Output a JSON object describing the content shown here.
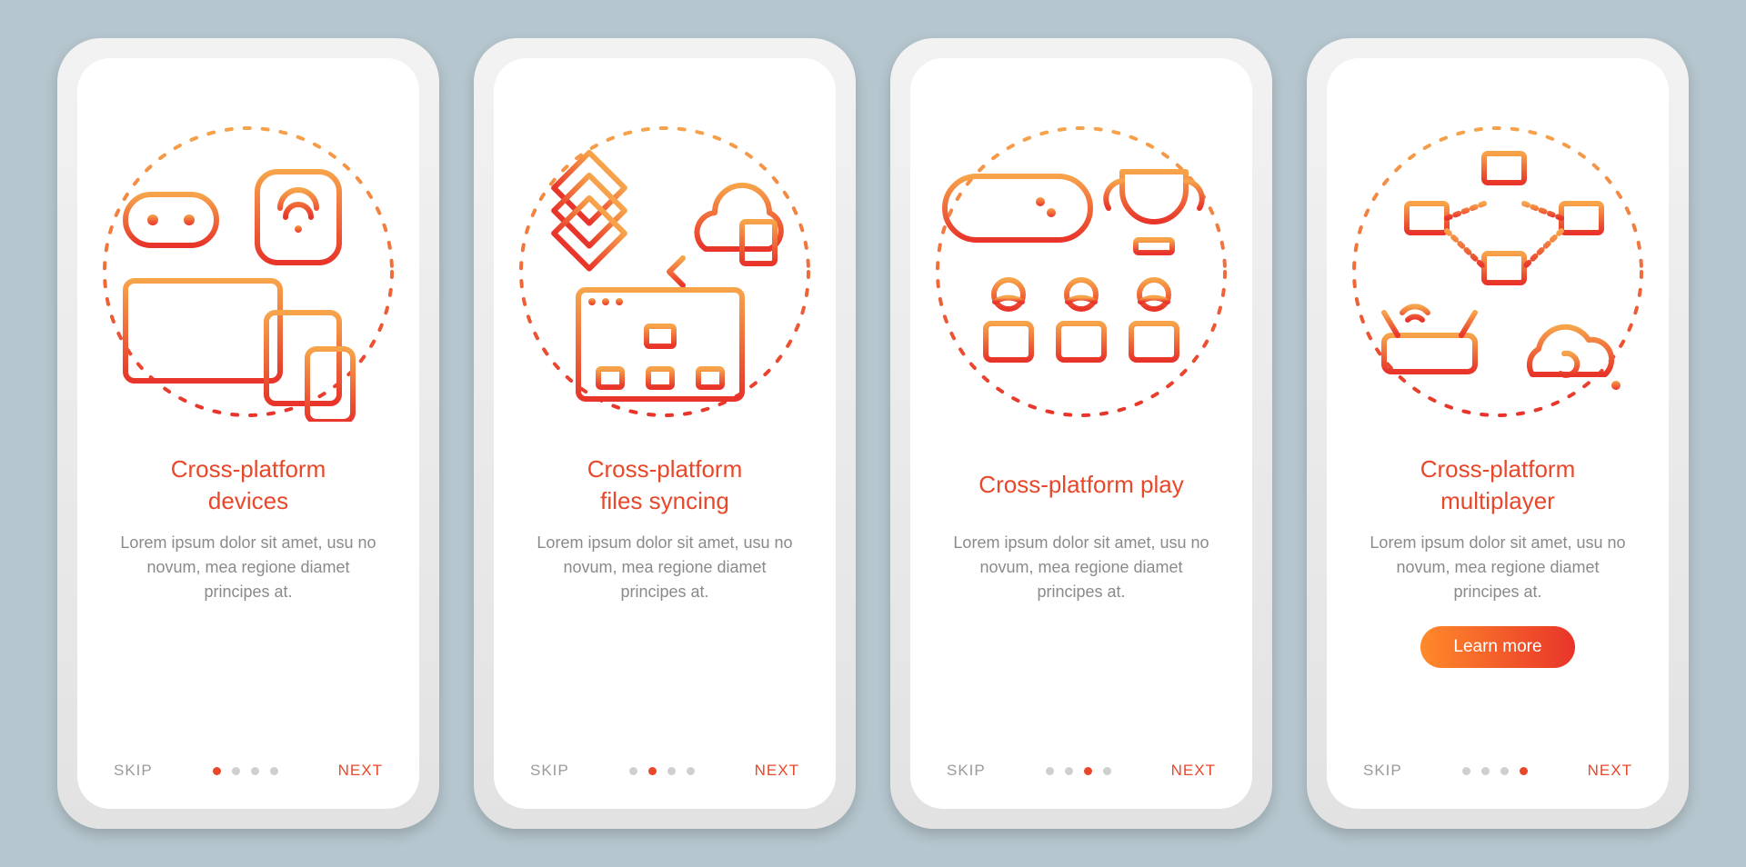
{
  "colors": {
    "accent": "#e8472a",
    "gradient_start": "#ff8a2a",
    "gradient_end": "#e8342a",
    "background": "#b6c6ce"
  },
  "common": {
    "skip": "SKIP",
    "next": "NEXT",
    "learn_more": "Learn more",
    "description": "Lorem ipsum dolor sit amet, usu no novum, mea regione diamet principes at."
  },
  "screens": [
    {
      "title": "Cross-platform\ndevices",
      "active_dot": 0,
      "show_cta": false,
      "icon": "devices"
    },
    {
      "title": "Cross-platform\nfiles syncing",
      "active_dot": 1,
      "show_cta": false,
      "icon": "files-sync"
    },
    {
      "title": "Cross-platform play",
      "active_dot": 2,
      "show_cta": false,
      "icon": "play"
    },
    {
      "title": "Cross-platform\nmultiplayer",
      "active_dot": 3,
      "show_cta": true,
      "icon": "multiplayer"
    }
  ]
}
